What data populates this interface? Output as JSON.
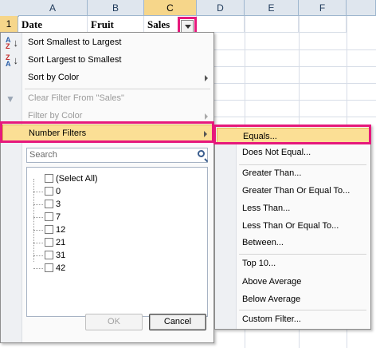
{
  "sheet": {
    "columns": [
      "A",
      "B",
      "C",
      "D",
      "E",
      "F"
    ],
    "selected_column": "C",
    "rows": [
      "1"
    ],
    "header_cells": [
      "Date",
      "Fruit",
      "Sales"
    ]
  },
  "menu": {
    "sort_smallest": "Sort Smallest to Largest",
    "sort_largest": "Sort Largest to Smallest",
    "sort_by_color": "Sort by Color",
    "clear_filter": "Clear Filter From \"Sales\"",
    "filter_by_color": "Filter by Color",
    "number_filters": "Number Filters",
    "search_placeholder": "Search",
    "list": [
      "(Select All)",
      "0",
      "3",
      "7",
      "12",
      "21",
      "31",
      "42"
    ],
    "ok": "OK",
    "cancel": "Cancel"
  },
  "submenu": {
    "items": [
      "Equals...",
      "Does Not Equal...",
      "Greater Than...",
      "Greater Than Or Equal To...",
      "Less Than...",
      "Less Than Or Equal To...",
      "Between...",
      "Top 10...",
      "Above Average",
      "Below Average",
      "Custom Filter..."
    ]
  },
  "colors": {
    "highlight_border": "#e6197c",
    "menu_hover": "#fbdf95",
    "selected_header": "#f6d68a"
  },
  "icons": [
    "sort-ascending-icon",
    "sort-descending-icon",
    "clear-filter-icon",
    "search-icon",
    "dropdown-arrow-icon",
    "submenu-arrow-icon"
  ]
}
